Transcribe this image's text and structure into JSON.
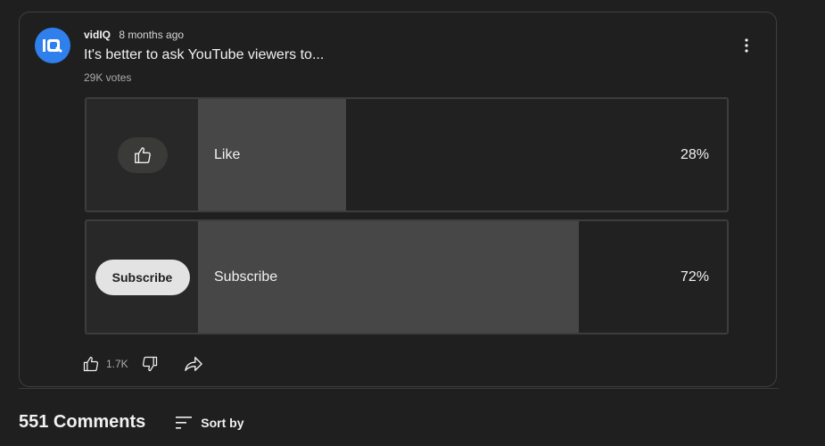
{
  "post": {
    "author": "vidIQ",
    "time_ago": "8 months ago",
    "question": "It's better to ask YouTube viewers to...",
    "votes": "29K votes",
    "avatar_icon": "vidiq-logo-icon",
    "avatar_color": "#2f80ed",
    "menu_icon": "more-vert-icon"
  },
  "poll": {
    "options": [
      {
        "label": "Like",
        "percent_text": "28%",
        "percent": 28,
        "thumb_icon": "thumbs-up-icon"
      },
      {
        "label": "Subscribe",
        "percent_text": "72%",
        "percent": 72,
        "thumb_button_label": "Subscribe"
      }
    ],
    "fill_color": "#474747"
  },
  "actions": {
    "like_icon": "thumbs-up-icon",
    "like_count": "1.7K",
    "dislike_icon": "thumbs-down-icon",
    "share_icon": "share-icon"
  },
  "comments": {
    "count_label": "551 Comments",
    "sort_icon": "sort-icon",
    "sort_label": "Sort by"
  }
}
